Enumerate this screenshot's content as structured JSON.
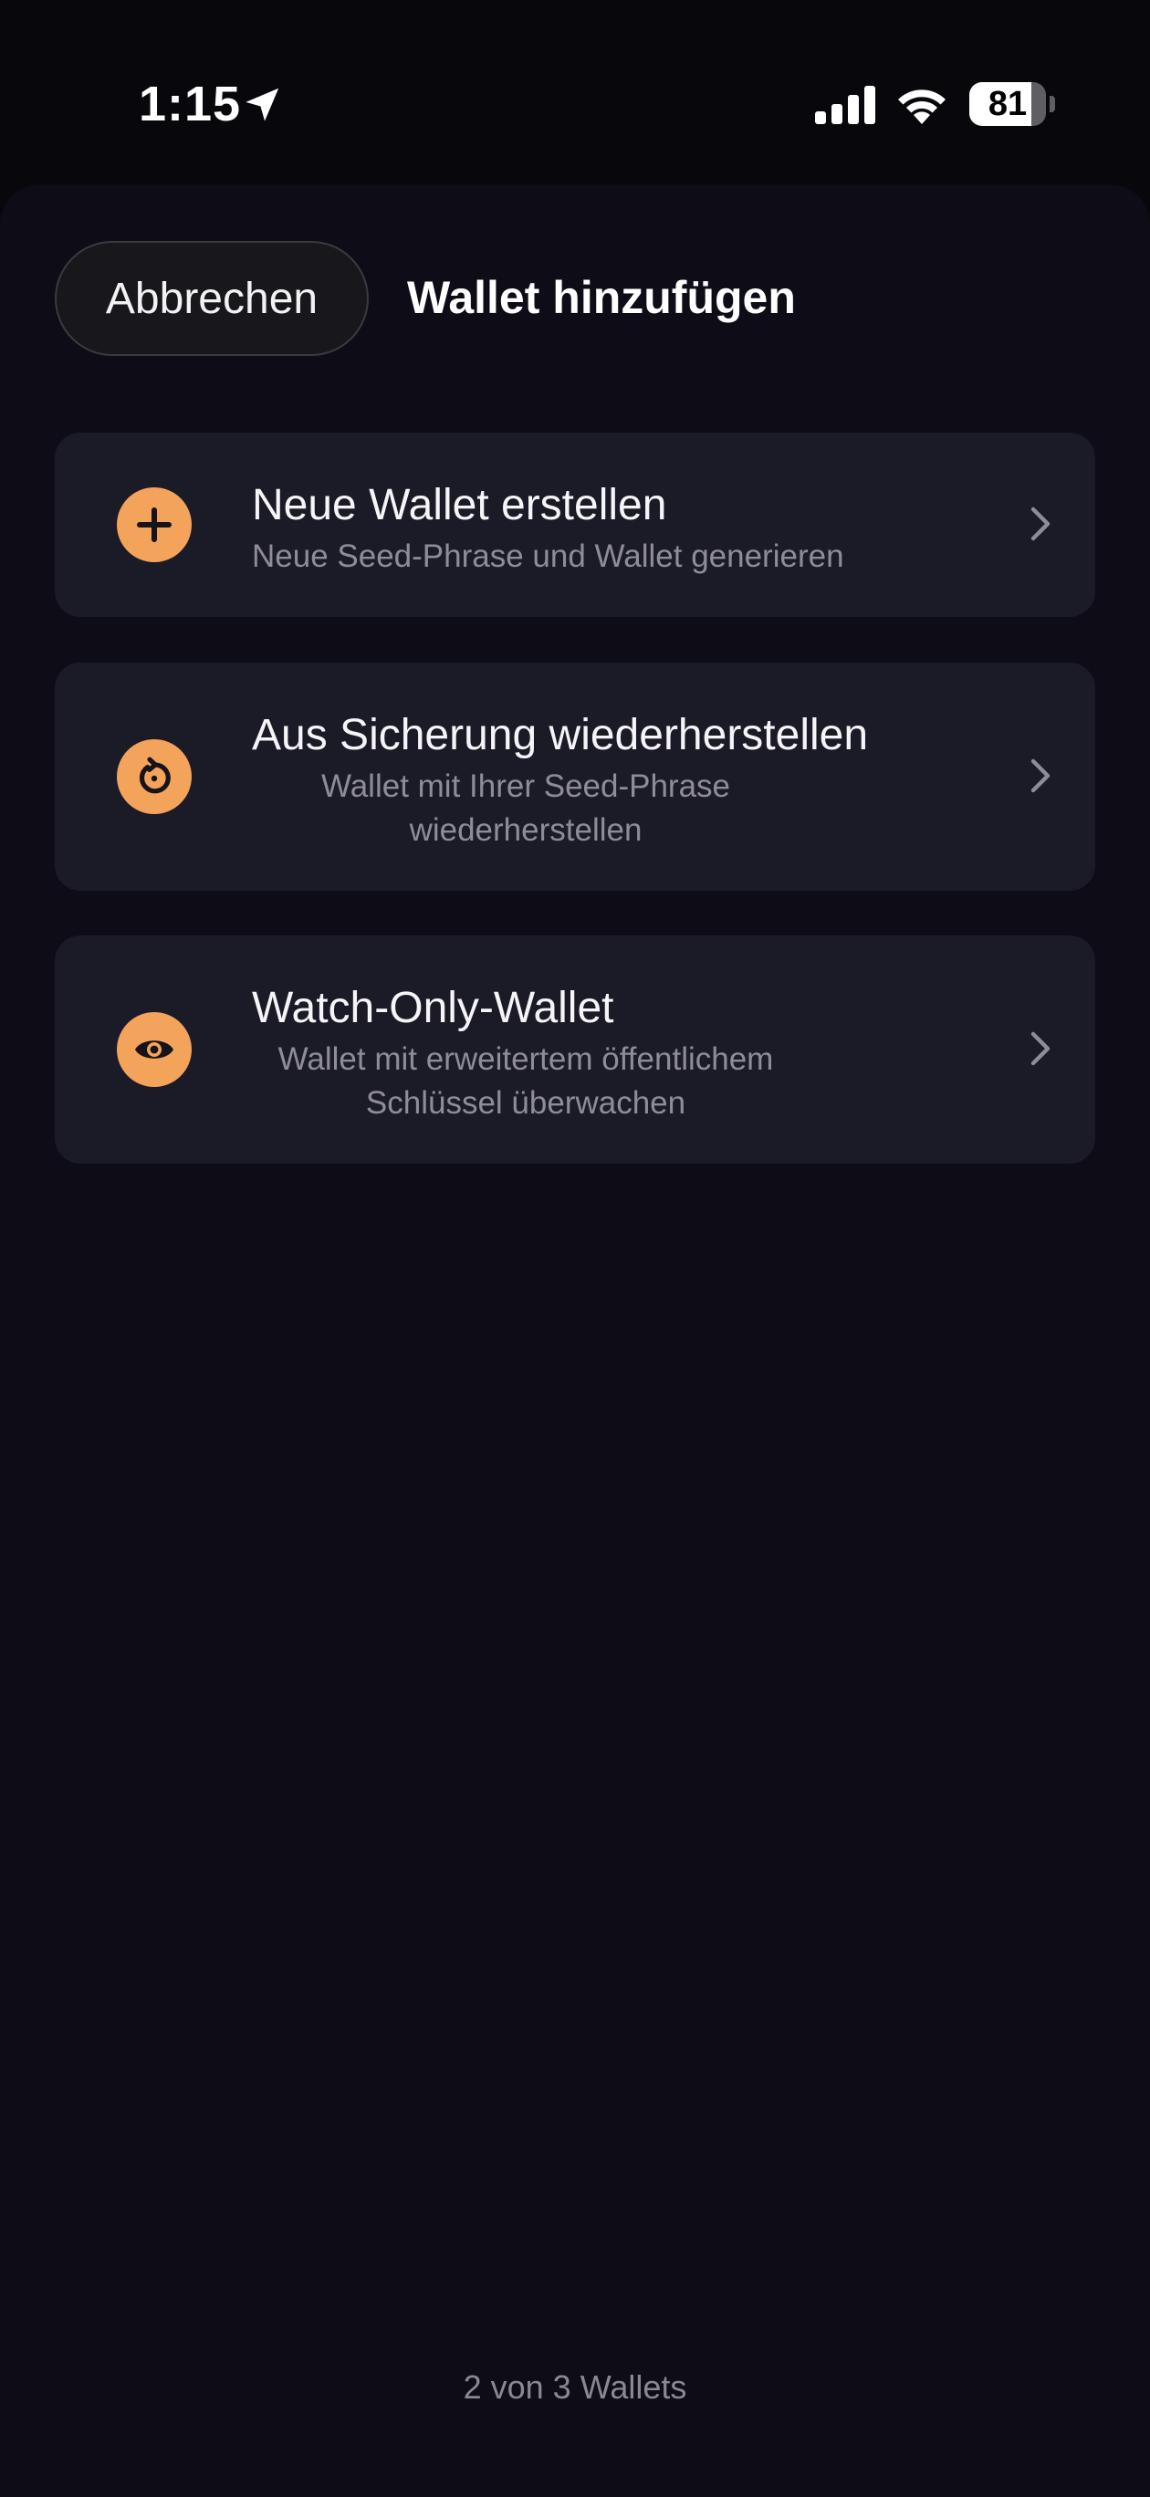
{
  "status_bar": {
    "time": "1:15",
    "battery_level": "81",
    "battery_fraction": 0.81,
    "icons": [
      "location-arrow-icon",
      "cellular-signal-icon",
      "wifi-icon",
      "battery-icon"
    ]
  },
  "sheet": {
    "cancel_label": "Abbrechen",
    "title": "Wallet hinzufügen"
  },
  "options": [
    {
      "icon": "plus-icon",
      "title": "Neue Wallet erstellen",
      "subtitle": "Neue Seed-Phrase und Wallet generieren"
    },
    {
      "icon": "restore-icon",
      "title": "Aus Sicherung wiederherstellen",
      "subtitle_line1": "Wallet mit Ihrer Seed-Phrase",
      "subtitle_line2": "wiederherstellen"
    },
    {
      "icon": "eye-icon",
      "title": "Watch-Only-Wallet",
      "subtitle_line1": "Wallet mit erweitertem öffentlichem",
      "subtitle_line2": "Schlüssel überwachen"
    }
  ],
  "footer": {
    "wallet_count": "2 von 3 Wallets"
  },
  "colors": {
    "accent": "#f4a35b",
    "sheet_background": "#0d0c17",
    "card_background": "#1b1a27",
    "secondary_text": "#8e8d97"
  }
}
